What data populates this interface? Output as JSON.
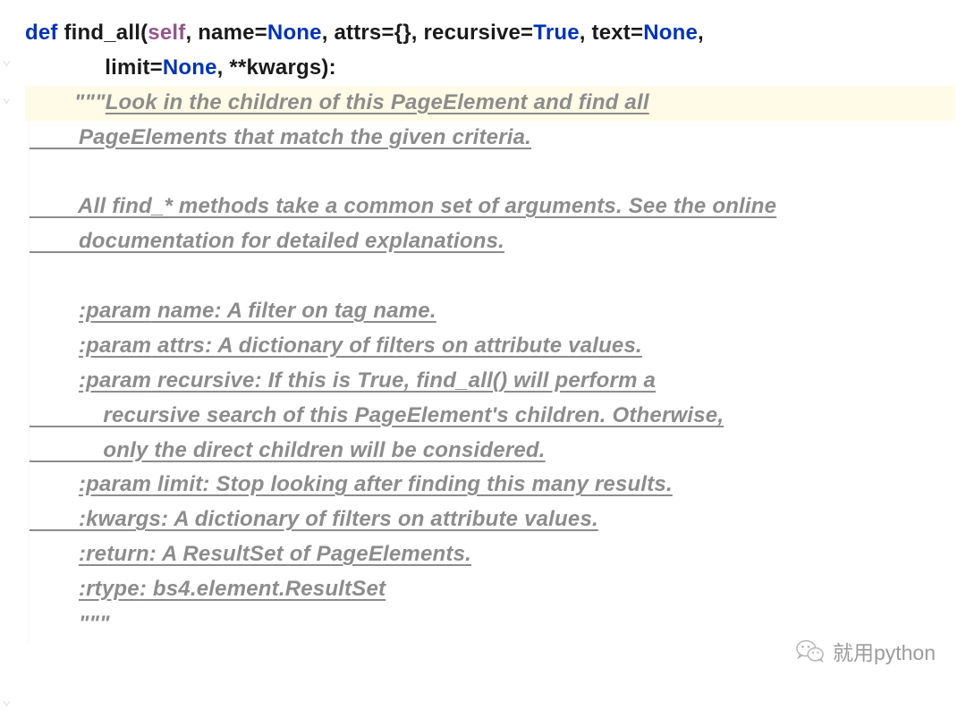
{
  "code": {
    "line1": {
      "def": "def ",
      "fn": "find_all",
      "open": "(",
      "self": "self",
      "p1": ", name=",
      "none1": "None",
      "p2": ", attrs={}, recursive=",
      "true1": "True",
      "p3": ", text=",
      "none2": "None",
      "p4": ","
    },
    "line2": {
      "indent": "             ",
      "p1": "limit=",
      "none1": "None",
      "p2": ", **kwargs):"
    },
    "doc": {
      "l1a": "        \"\"\"",
      "l1b": "Look in the children of this PageElement and find all",
      "l2": "        PageElements that match the given criteria.",
      "blank1": " ",
      "l3": "        All find_* methods take a common set of arguments. See the online",
      "l4": "        documentation for detailed explanations.",
      "blank2": " ",
      "l5a": "        ",
      "l5p": ":param",
      "l5b": " name: A filter on tag name.",
      "l6a": "        ",
      "l6p": ":param",
      "l6b": " attrs: A dictionary of filters on attribute values.",
      "l7a": "        ",
      "l7p": ":param",
      "l7b": " recursive: If this is True, find_all() will perform a",
      "l8": "            recursive search of this PageElement's children. Otherwise,",
      "l9": "            only the direct children will be considered.",
      "l10a": "        ",
      "l10p": ":param",
      "l10b": " limit: Stop looking after finding this many results.",
      "l11": "        :kwargs: A dictionary of filters on attribute values.",
      "l12a": "        ",
      "l12p": ":return",
      "l12b": ": A ResultSet of PageElements.",
      "l13a": "        ",
      "l13p": ":rtype",
      "l13b": ": bs4.element.ResultSet",
      "l14": "        \"\"\""
    }
  },
  "gutter": {
    "mark": "⌄"
  },
  "watermark": {
    "text": "就用python"
  }
}
